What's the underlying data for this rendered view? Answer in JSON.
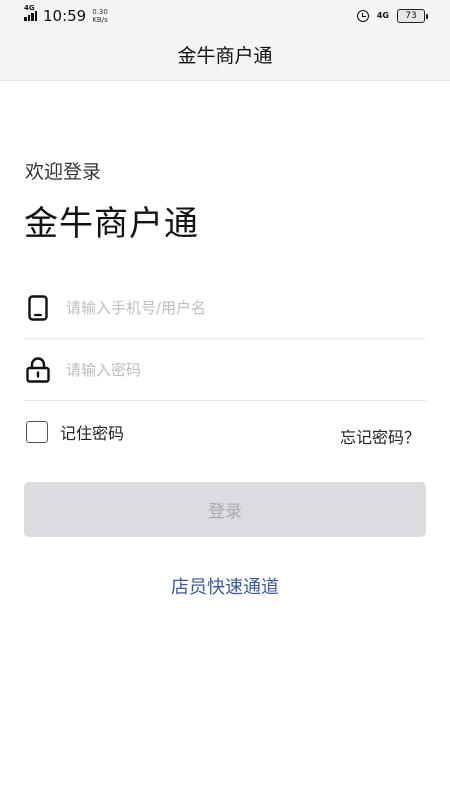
{
  "status_bar": {
    "network_left": "4G",
    "time": "10:59",
    "speed_value": "0.30",
    "speed_unit": "KB/s",
    "network_right": "4G",
    "battery": "73"
  },
  "app_bar": {
    "title": "金牛商户通"
  },
  "login": {
    "welcome": "欢迎登录",
    "brand": "金牛商户通",
    "username_placeholder": "请输入手机号/用户名",
    "password_placeholder": "请输入密码",
    "remember_label": "记住密码",
    "forgot_label": "忘记密码？",
    "submit_label": "登录",
    "staff_link": "店员快速通道"
  },
  "icons": {
    "username": "phone-icon",
    "password": "lock-icon"
  },
  "colors": {
    "link": "#3b5a9e",
    "button_disabled_bg": "#dcdbe0",
    "button_disabled_text": "#a9a8ae",
    "placeholder": "#bdbdc2"
  }
}
